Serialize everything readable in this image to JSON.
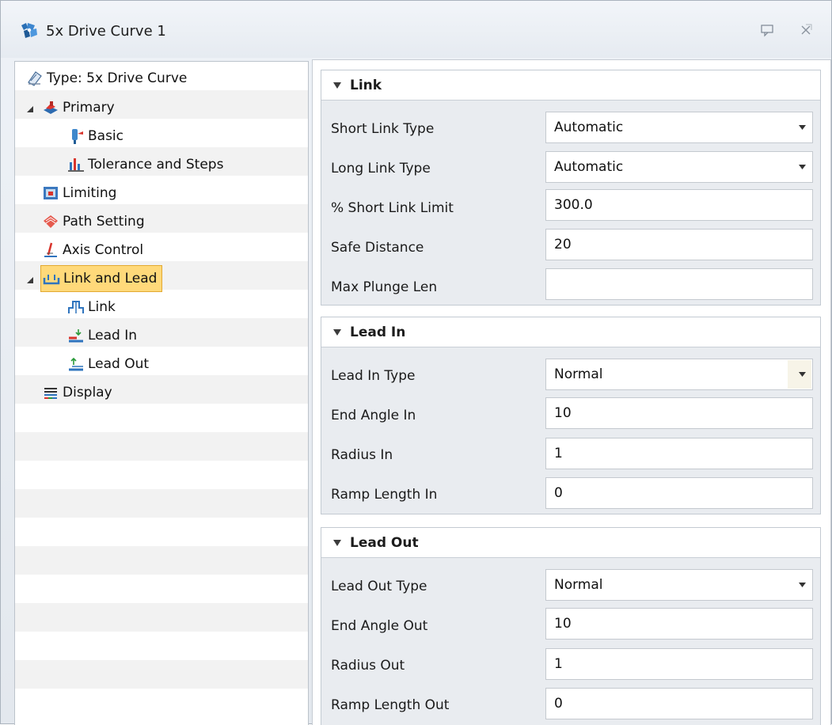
{
  "window": {
    "title": "5x Drive Curve 1",
    "accent_color": "#ffd97a"
  },
  "tree": {
    "items": [
      {
        "label": "Type: 5x Drive Curve",
        "icon": "type-icon"
      },
      {
        "label": "Primary",
        "icon": "primary-icon"
      },
      {
        "label": "Basic",
        "icon": "basic-icon"
      },
      {
        "label": "Tolerance and Steps",
        "icon": "tolerance-icon"
      },
      {
        "label": "Limiting",
        "icon": "limiting-icon"
      },
      {
        "label": "Path Setting",
        "icon": "path-setting-icon"
      },
      {
        "label": "Axis Control",
        "icon": "axis-control-icon"
      },
      {
        "label": "Link and Lead",
        "icon": "link-lead-icon"
      },
      {
        "label": "Link",
        "icon": "link-icon"
      },
      {
        "label": "Lead In",
        "icon": "lead-in-icon"
      },
      {
        "label": "Lead Out",
        "icon": "lead-out-icon"
      },
      {
        "label": "Display",
        "icon": "display-icon"
      }
    ],
    "selected": "Link and Lead"
  },
  "link": {
    "title": "Link",
    "short_link_type": {
      "label": "Short Link Type",
      "value": "Automatic"
    },
    "long_link_type": {
      "label": "Long Link Type",
      "value": "Automatic"
    },
    "short_link_limit": {
      "label": "% Short Link Limit",
      "value": "300.0"
    },
    "safe_distance": {
      "label": "Safe Distance",
      "value": "20"
    },
    "max_plunge_len": {
      "label": "Max Plunge Len",
      "value": ""
    }
  },
  "lead_in": {
    "title": "Lead In",
    "type": {
      "label": "Lead In Type",
      "value": "Normal"
    },
    "end_angle": {
      "label": "End Angle In",
      "value": "10"
    },
    "radius": {
      "label": "Radius In",
      "value": "1"
    },
    "ramp_length": {
      "label": "Ramp Length In",
      "value": "0"
    }
  },
  "lead_out": {
    "title": "Lead Out",
    "type": {
      "label": "Lead Out Type",
      "value": "Normal"
    },
    "end_angle": {
      "label": "End Angle Out",
      "value": "10"
    },
    "radius": {
      "label": "Radius Out",
      "value": "1"
    },
    "ramp_length": {
      "label": "Ramp Length Out",
      "value": "0"
    }
  }
}
